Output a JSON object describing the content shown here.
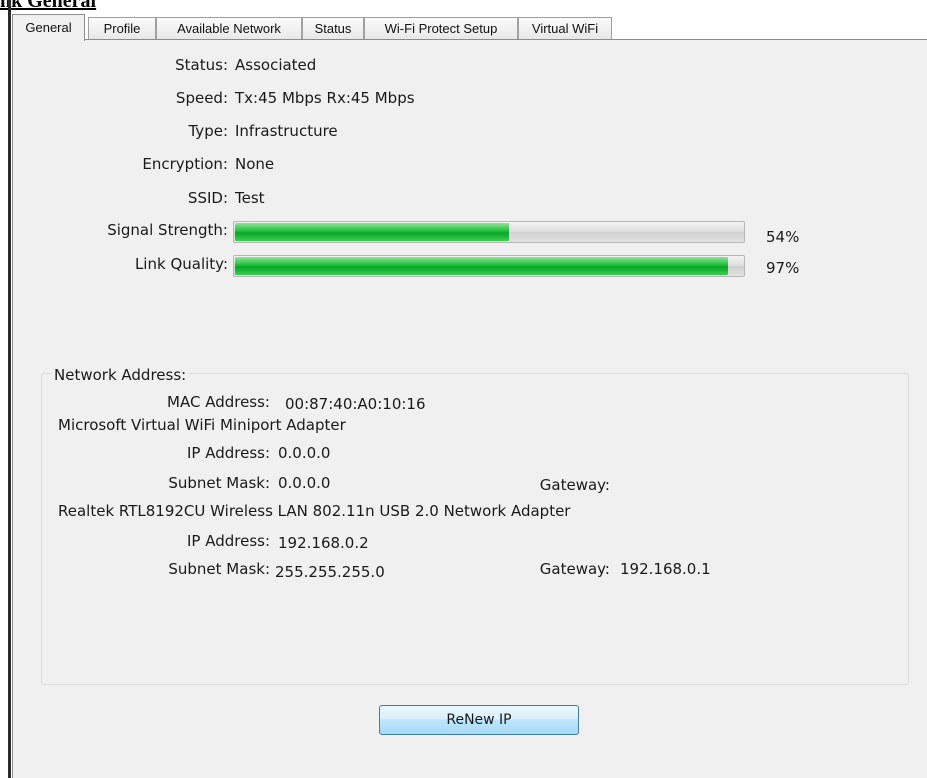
{
  "page_heading": "nk General",
  "tabs": [
    {
      "label": "General",
      "active": true
    },
    {
      "label": "Profile",
      "active": false
    },
    {
      "label": "Available Network",
      "active": false
    },
    {
      "label": "Status",
      "active": false
    },
    {
      "label": "Wi-Fi Protect Setup",
      "active": false
    },
    {
      "label": "Virtual WiFi",
      "active": false
    }
  ],
  "general": {
    "status_label": "Status:",
    "status_value": "Associated",
    "speed_label": "Speed:",
    "speed_value": "Tx:45 Mbps Rx:45 Mbps",
    "type_label": "Type:",
    "type_value": "Infrastructure",
    "encryption_label": "Encryption:",
    "encryption_value": "None",
    "ssid_label": "SSID:",
    "ssid_value": "Test",
    "signal_label": "Signal Strength:",
    "signal_percent_text": "54%",
    "signal_level": 0.54,
    "link_label": "Link Quality:",
    "link_percent_text": "97%",
    "link_level": 0.97
  },
  "network_address": {
    "title": "Network Address:",
    "mac_label": "MAC Address:",
    "mac_value": "00:87:40:A0:10:16",
    "adapters": [
      {
        "name": "Microsoft Virtual WiFi Miniport Adapter",
        "ip_label": "IP Address:",
        "ip_value": "0.0.0.0",
        "mask_label": "Subnet Mask:",
        "mask_value": "0.0.0.0",
        "gateway_label": "Gateway:",
        "gateway_value": ""
      },
      {
        "name": "Realtek RTL8192CU Wireless LAN 802.11n USB 2.0 Network Adapter",
        "ip_label": "IP Address:",
        "ip_value": "192.168.0.2",
        "mask_label": "Subnet Mask:",
        "mask_value": "255.255.255.0",
        "gateway_label": "Gateway:",
        "gateway_value": "192.168.0.1"
      }
    ]
  },
  "buttons": {
    "renew_label": "ReNew IP"
  },
  "colors": {
    "bar_green": "#1fbf3a",
    "button_border": "#3c7fb1",
    "panel_bg": "#f0f0f0"
  }
}
